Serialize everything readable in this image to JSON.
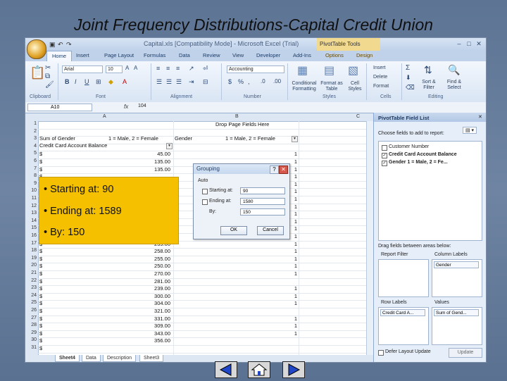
{
  "slide": {
    "title": "Joint Frequency Distributions-Capital Credit Union"
  },
  "excel": {
    "window_title": "Capital.xls [Compatibility Mode] - Microsoft Excel (Trial)",
    "contextual_tab": "PivotTable Tools",
    "tabs": [
      "Home",
      "Insert",
      "Page Layout",
      "Formulas",
      "Data",
      "Review",
      "View",
      "Developer",
      "Add-Ins",
      "Options",
      "Design"
    ],
    "ribbon": {
      "font_name": "Arial",
      "font_size": "10",
      "number_format": "Accounting",
      "groups": [
        "Clipboard",
        "Font",
        "Alignment",
        "Number",
        "Styles",
        "Cells",
        "Editing"
      ],
      "styles_buttons": [
        "Conditional Formatting",
        "Format as Table",
        "Cell Styles"
      ],
      "cells_buttons": [
        "Insert",
        "Delete",
        "Format"
      ],
      "editing_buttons": [
        "Sort & Filter",
        "Find & Select"
      ]
    },
    "formula_bar": {
      "name_box": "A10",
      "fx": "fx",
      "value": "104"
    },
    "columns": [
      "A",
      "B",
      "C"
    ],
    "drop_zone": "Drop Page Fields Here",
    "header_row": {
      "a": "Sum of Gender",
      "a2": "1 = Male, 2 = Female",
      "b": "Gender",
      "b2": "1 = Male, 2 = Female"
    },
    "subheader": "Credit Card Account Balance",
    "rows": [
      {
        "n": "1",
        "a": "",
        "b": ""
      },
      {
        "n": "2",
        "a": "",
        "b": ""
      },
      {
        "n": "3",
        "a": "",
        "b": ""
      },
      {
        "n": "4",
        "a": "",
        "b": ""
      },
      {
        "n": "5",
        "a": "45.00",
        "b": "1"
      },
      {
        "n": "6",
        "a": "135.00",
        "b": "1"
      },
      {
        "n": "7",
        "a": "135.00",
        "b": "1"
      },
      {
        "n": "8",
        "a": "",
        "b": "1"
      },
      {
        "n": "9",
        "a": "",
        "b": "1"
      },
      {
        "n": "10",
        "a": "",
        "b": "1"
      },
      {
        "n": "11",
        "a": "",
        "b": "1"
      },
      {
        "n": "12",
        "a": "",
        "b": "1"
      },
      {
        "n": "13",
        "a": "",
        "b": "1"
      },
      {
        "n": "14",
        "a": "",
        "b": "1"
      },
      {
        "n": "15",
        "a": "",
        "b": "1"
      },
      {
        "n": "16",
        "a": "",
        "b": "1"
      },
      {
        "n": "17",
        "a": "239.00",
        "b": "1"
      },
      {
        "n": "18",
        "a": "258.00",
        "b": "1"
      },
      {
        "n": "19",
        "a": "255.00",
        "b": "1"
      },
      {
        "n": "20",
        "a": "250.00",
        "b": "1"
      },
      {
        "n": "21",
        "a": "270.00",
        "b": "1"
      },
      {
        "n": "22",
        "a": "281.00",
        "b": ""
      },
      {
        "n": "23",
        "a": "239.00",
        "b": "1"
      },
      {
        "n": "24",
        "a": "300.00",
        "b": "1"
      },
      {
        "n": "25",
        "a": "304.00",
        "b": "1"
      },
      {
        "n": "26",
        "a": "321.00",
        "b": ""
      },
      {
        "n": "27",
        "a": "331.00",
        "b": "1"
      },
      {
        "n": "28",
        "a": "309.00",
        "b": "1"
      },
      {
        "n": "29",
        "a": "343.00",
        "b": "1"
      },
      {
        "n": "30",
        "a": "356.00",
        "b": ""
      },
      {
        "n": "31",
        "a": "",
        "b": ""
      }
    ],
    "sheet_tabs": [
      "Sheet4",
      "Data",
      "Description",
      "Sheet3"
    ],
    "pivot_pane": {
      "title": "PivotTable Field List",
      "choose_label": "Choose fields to add to report:",
      "fields": [
        {
          "label": "Customer Number",
          "checked": false
        },
        {
          "label": "Credit Card Account Balance",
          "checked": true
        },
        {
          "label": "Gender    1 = Male, 2 = Fe...",
          "checked": true
        }
      ],
      "drag_label": "Drag fields between areas below:",
      "areas": {
        "report_filter": "Report Filter",
        "column_labels": "Column Labels",
        "column_item": "Gender",
        "row_labels": "Row Labels",
        "row_item": "Credit Card A...",
        "values": "Values",
        "values_item": "Sum of Gend..."
      },
      "defer": "Defer Layout Update",
      "update": "Update"
    },
    "grouping_dialog": {
      "title": "Grouping",
      "auto": "Auto",
      "starting_label": "Starting at:",
      "starting_value": "90",
      "ending_label": "Ending at:",
      "ending_value": "1580",
      "by_label": "By:",
      "by_value": "150",
      "ok": "OK",
      "cancel": "Cancel"
    }
  },
  "annotation": {
    "items": [
      "• Starting at: 90",
      "• Ending at: 1589",
      "• By: 150"
    ]
  },
  "colors": {
    "note": "#f5c000",
    "slide_bg": "#5b7191"
  }
}
